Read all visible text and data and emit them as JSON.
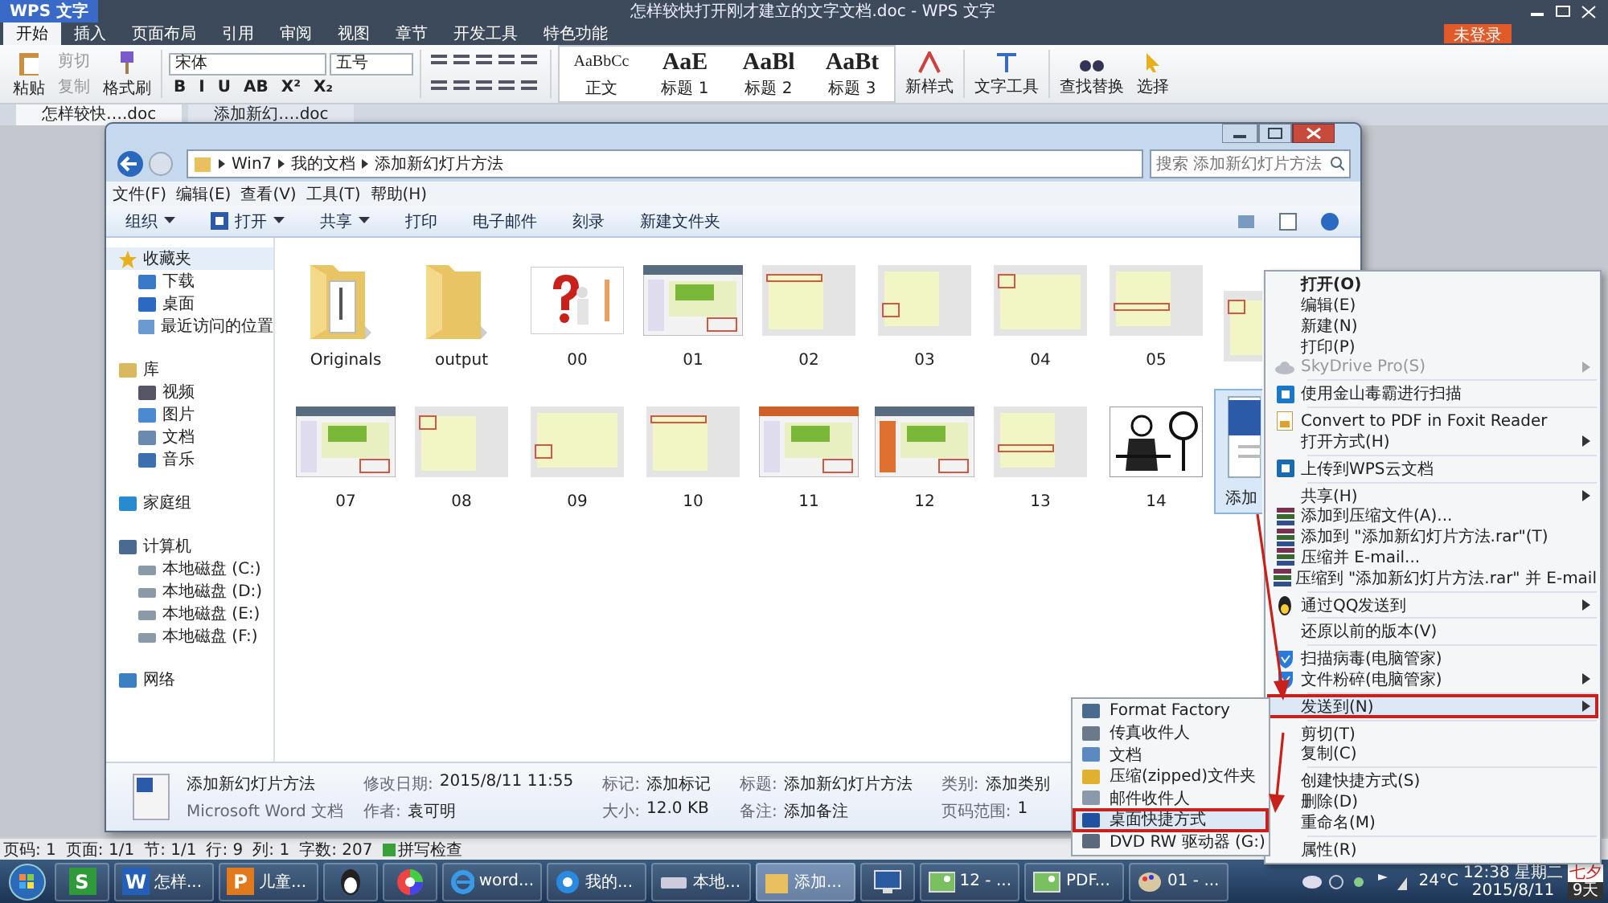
{
  "app": {
    "logo": "WPS 文字",
    "title": "怎样较快打开刚才建立的文字文档.doc - WPS 文字",
    "login": "未登录"
  },
  "ribbon_tabs": [
    {
      "label": "开始",
      "selected": true
    },
    {
      "label": "插入",
      "selected": false
    },
    {
      "label": "页面布局",
      "selected": false
    },
    {
      "label": "引用",
      "selected": false
    },
    {
      "label": "审阅",
      "selected": false
    },
    {
      "label": "视图",
      "selected": false
    },
    {
      "label": "章节",
      "selected": false
    },
    {
      "label": "开发工具",
      "selected": false
    },
    {
      "label": "特色功能",
      "selected": false
    }
  ],
  "ribbon": {
    "paste": "粘贴",
    "cut": {
      "label": "剪切",
      "disabled": true
    },
    "copy": {
      "label": "复制",
      "disabled": true
    },
    "format_painter": "格式刷",
    "font": "宋体",
    "size": "五号",
    "font_buttons": [
      "B",
      "I",
      "U",
      "AB",
      "X²",
      "X₂"
    ],
    "styles": [
      {
        "sample": "AaBbCc",
        "label": "正文"
      },
      {
        "sample": "AaE",
        "label": "标题 1"
      },
      {
        "sample": "AaBl",
        "label": "标题 2"
      },
      {
        "sample": "AaBt",
        "label": "标题 3"
      }
    ],
    "new_style": "新样式",
    "text_tools": "文字工具",
    "find_replace": "查找替换",
    "select": "选择"
  },
  "doc_tabs": [
    {
      "label": "怎样较快….doc",
      "selected": true
    },
    {
      "label": "添加新幻….doc",
      "selected": false
    }
  ],
  "explorer": {
    "breadcrumb": [
      "Win7",
      "我的文档",
      "添加新幻灯片方法"
    ],
    "search_placeholder": "搜索 添加新幻灯片方法",
    "menu": [
      "文件(F)",
      "编辑(E)",
      "查看(V)",
      "工具(T)",
      "帮助(H)"
    ],
    "toolbar": [
      {
        "label": "组织",
        "dropdown": true,
        "kind": "text"
      },
      {
        "label": "打开",
        "dropdown": true,
        "kind": "word"
      },
      {
        "label": "共享",
        "dropdown": true,
        "kind": "text"
      },
      {
        "label": "打印",
        "dropdown": false,
        "kind": "text"
      },
      {
        "label": "电子邮件",
        "dropdown": false,
        "kind": "text"
      },
      {
        "label": "刻录",
        "dropdown": false,
        "kind": "text"
      },
      {
        "label": "新建文件夹",
        "dropdown": false,
        "kind": "text"
      }
    ],
    "sidebar": [
      {
        "label": "收藏夹",
        "kind": "star",
        "selected": true,
        "children": [
          {
            "label": "下载",
            "kind": "download",
            "selected": false
          },
          {
            "label": "桌面",
            "kind": "desktop",
            "selected": false
          },
          {
            "label": "最近访问的位置",
            "kind": "recent",
            "selected": false
          }
        ]
      },
      {
        "label": "库",
        "kind": "library",
        "selected": false,
        "children": [
          {
            "label": "视频",
            "kind": "video",
            "selected": false
          },
          {
            "label": "图片",
            "kind": "pictures",
            "selected": false
          },
          {
            "label": "文档",
            "kind": "docs",
            "selected": false
          },
          {
            "label": "音乐",
            "kind": "music",
            "selected": false
          }
        ]
      },
      {
        "label": "家庭组",
        "kind": "homegroup",
        "selected": false
      },
      {
        "label": "计算机",
        "kind": "computer",
        "selected": false,
        "children": [
          {
            "label": "本地磁盘 (C:)",
            "kind": "drive",
            "selected": false
          },
          {
            "label": "本地磁盘 (D:)",
            "kind": "drive",
            "selected": false
          },
          {
            "label": "本地磁盘 (E:)",
            "kind": "drive",
            "selected": false
          },
          {
            "label": "本地磁盘 (F:)",
            "kind": "drive",
            "selected": false
          }
        ]
      },
      {
        "label": "网络",
        "kind": "network",
        "selected": false
      }
    ],
    "file_rows": [
      [
        {
          "name": "Originals",
          "kind": "folder-docs",
          "selected": false
        },
        {
          "name": "output",
          "kind": "folder",
          "selected": false
        },
        {
          "name": "00",
          "kind": "question",
          "selected": false
        },
        {
          "name": "01",
          "kind": "screen",
          "selected": false
        },
        {
          "name": "02",
          "kind": "slide",
          "selected": false
        },
        {
          "name": "03",
          "kind": "slide",
          "selected": false
        },
        {
          "name": "04",
          "kind": "slide",
          "selected": false
        },
        {
          "name": "05",
          "kind": "slide",
          "selected": false
        },
        {
          "kind": "slide",
          "selected": false
        }
      ],
      [
        {
          "name": "07",
          "kind": "screen",
          "selected": false
        },
        {
          "name": "08",
          "kind": "slide",
          "selected": false
        },
        {
          "name": "09",
          "kind": "slide",
          "selected": false
        },
        {
          "name": "10",
          "kind": "slide",
          "selected": false
        },
        {
          "name": "11",
          "kind": "screen",
          "selected": false
        },
        {
          "name": "12",
          "kind": "screen",
          "selected": false
        },
        {
          "name": "13",
          "kind": "slide",
          "selected": false
        },
        {
          "name": "14",
          "kind": "figure",
          "selected": false
        },
        {
          "name": "添加",
          "kind": "word",
          "selected": true
        }
      ]
    ],
    "details": {
      "name": "添加新幻灯片方法",
      "type": "Microsoft Word 文档",
      "fields": [
        {
          "label": "修改日期:",
          "value": "2015/8/11 11:55"
        },
        {
          "label": "作者:",
          "value": "袁可明"
        },
        {
          "label": "标记:",
          "value": "添加标记"
        },
        {
          "label": "大小:",
          "value": "12.0 KB"
        },
        {
          "label": "标题:",
          "value": "添加新幻灯片方法"
        },
        {
          "label": "备注:",
          "value": "添加备注"
        },
        {
          "label": "类别:",
          "value": "添加类别"
        },
        {
          "label": "页码范围:",
          "value": "1"
        }
      ]
    }
  },
  "context_menu": [
    {
      "kind": "text",
      "label": "打开(O)",
      "default": true,
      "disabled": false,
      "submenu": false,
      "selected": false
    },
    {
      "kind": "text",
      "label": "编辑(E)",
      "default": false,
      "disabled": false,
      "submenu": false,
      "selected": false
    },
    {
      "kind": "text",
      "label": "新建(N)",
      "default": false,
      "disabled": false,
      "submenu": false,
      "selected": false
    },
    {
      "kind": "text",
      "label": "打印(P)",
      "default": false,
      "disabled": false,
      "submenu": false,
      "selected": false
    },
    {
      "kind": "cloud",
      "label": "SkyDrive Pro(S)",
      "default": false,
      "disabled": true,
      "submenu": true,
      "selected": false
    },
    {
      "kind": "separator"
    },
    {
      "kind": "scan",
      "label": "使用金山毒霸进行扫描",
      "default": false,
      "disabled": false,
      "submenu": false,
      "selected": false
    },
    {
      "kind": "separator"
    },
    {
      "kind": "pdf",
      "label": "Convert to PDF in Foxit Reader",
      "default": false,
      "disabled": false,
      "submenu": false,
      "selected": false
    },
    {
      "kind": "text",
      "label": "打开方式(H)",
      "default": false,
      "disabled": false,
      "submenu": true,
      "selected": false
    },
    {
      "kind": "separator"
    },
    {
      "kind": "upload",
      "label": "上传到WPS云文档",
      "default": false,
      "disabled": false,
      "submenu": false,
      "selected": false
    },
    {
      "kind": "separator"
    },
    {
      "kind": "text",
      "label": "共享(H)",
      "default": false,
      "disabled": false,
      "submenu": true,
      "selected": false
    },
    {
      "kind": "archive",
      "label": "添加到压缩文件(A)...",
      "default": false,
      "disabled": false,
      "submenu": false,
      "selected": false
    },
    {
      "kind": "archive",
      "label": "添加到 \"添加新幻灯片方法.rar\"(T)",
      "default": false,
      "disabled": false,
      "submenu": false,
      "selected": false
    },
    {
      "kind": "archive",
      "label": "压缩并 E-mail...",
      "default": false,
      "disabled": false,
      "submenu": false,
      "selected": false
    },
    {
      "kind": "archive",
      "label": "压缩到 \"添加新幻灯片方法.rar\" 并 E-mail",
      "default": false,
      "disabled": false,
      "submenu": false,
      "selected": false
    },
    {
      "kind": "separator"
    },
    {
      "kind": "qq",
      "label": "通过QQ发送到",
      "default": false,
      "disabled": false,
      "submenu": true,
      "selected": false
    },
    {
      "kind": "separator"
    },
    {
      "kind": "text",
      "label": "还原以前的版本(V)",
      "default": false,
      "disabled": false,
      "submenu": false,
      "selected": false
    },
    {
      "kind": "separator"
    },
    {
      "kind": "shield",
      "label": "扫描病毒(电脑管家)",
      "default": false,
      "disabled": false,
      "submenu": false,
      "selected": false
    },
    {
      "kind": "shield",
      "label": "文件粉碎(电脑管家)",
      "default": false,
      "disabled": false,
      "submenu": true,
      "selected": false
    },
    {
      "kind": "separator"
    },
    {
      "kind": "text",
      "label": "发送到(N)",
      "default": false,
      "disabled": false,
      "submenu": true,
      "selected": true
    },
    {
      "kind": "separator"
    },
    {
      "kind": "text",
      "label": "剪切(T)",
      "default": false,
      "disabled": false,
      "submenu": false,
      "selected": false
    },
    {
      "kind": "text",
      "label": "复制(C)",
      "default": false,
      "disabled": false,
      "submenu": false,
      "selected": false
    },
    {
      "kind": "separator"
    },
    {
      "kind": "text",
      "label": "创建快捷方式(S)",
      "default": false,
      "disabled": false,
      "submenu": false,
      "selected": false
    },
    {
      "kind": "text",
      "label": "删除(D)",
      "default": false,
      "disabled": false,
      "submenu": false,
      "selected": false
    },
    {
      "kind": "text",
      "label": "重命名(M)",
      "default": false,
      "disabled": false,
      "submenu": false,
      "selected": false
    },
    {
      "kind": "separator"
    },
    {
      "kind": "text",
      "label": "属性(R)",
      "default": false,
      "disabled": false,
      "submenu": false,
      "selected": false
    }
  ],
  "send_to_menu": [
    {
      "kind": "factory",
      "label": "Format Factory",
      "selected": false
    },
    {
      "kind": "fax",
      "label": "传真收件人",
      "selected": false
    },
    {
      "kind": "docs",
      "label": "文档",
      "selected": false
    },
    {
      "kind": "zip",
      "label": "压缩(zipped)文件夹",
      "selected": false
    },
    {
      "kind": "mail",
      "label": "邮件收件人",
      "selected": false
    },
    {
      "kind": "desktop",
      "label": "桌面快捷方式",
      "selected": true
    },
    {
      "kind": "dvd",
      "label": "DVD RW 驱动器 (G:)",
      "selected": false
    }
  ],
  "status_bar": [
    "页码: 1",
    "页面: 1/1",
    "节: 1/1",
    "行: 9",
    "列: 1",
    "字数: 207"
  ],
  "spell_check": {
    "label": "拼写检查",
    "checked": true
  },
  "taskbar": {
    "items": [
      {
        "kind": "glyph",
        "glyph": "S",
        "color": "#2f9a3a",
        "selected": false
      },
      {
        "kind": "glyph",
        "glyph": "W",
        "color": "#2560b8",
        "label": "怎样...",
        "selected": false
      },
      {
        "kind": "glyph",
        "glyph": "P",
        "color": "#e07a1c",
        "label": "儿童...",
        "selected": false
      },
      {
        "kind": "qq",
        "selected": false
      },
      {
        "kind": "wheel",
        "selected": false
      },
      {
        "kind": "ie",
        "label": "word...",
        "selected": false
      },
      {
        "kind": "browser",
        "label": "我的...",
        "selected": false
      },
      {
        "kind": "drive",
        "label": "本地...",
        "selected": false
      },
      {
        "kind": "folder",
        "label": "添加...",
        "selected": true
      },
      {
        "kind": "monitor",
        "selected": false
      },
      {
        "label": "12 - ...",
        "selected": false
      },
      {
        "label": "PDF...",
        "selected": false
      },
      {
        "kind": "paint",
        "label": "01 - ...",
        "selected": false
      }
    ],
    "temperature": "24°C",
    "time": "12:38 星期二",
    "date": "2015/8/11",
    "calendar_top": "七夕",
    "calendar_bottom": "9天"
  }
}
